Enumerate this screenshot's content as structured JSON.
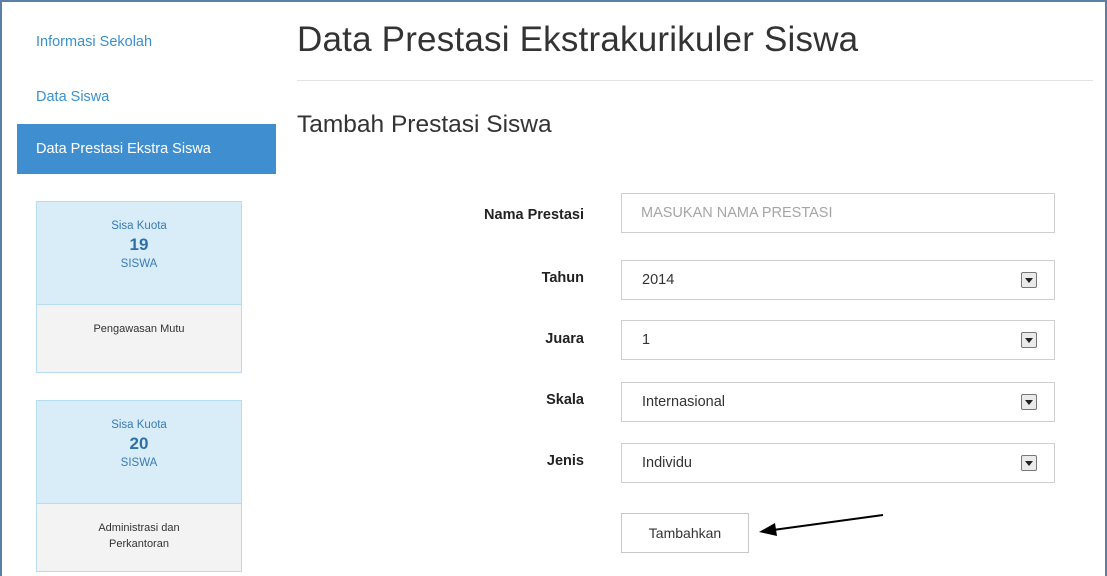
{
  "sidebar": {
    "items": [
      {
        "label": "Informasi Sekolah"
      },
      {
        "label": "Data Siswa"
      },
      {
        "label": "Data Prestasi Ekstra Siswa"
      }
    ],
    "quotas": [
      {
        "label": "Sisa Kuota",
        "count": "19",
        "unit": "SISWA",
        "program": "Pengawasan Mutu"
      },
      {
        "label": "Sisa Kuota",
        "count": "20",
        "unit": "SISWA",
        "program": "Administrasi dan Perkantoran"
      }
    ]
  },
  "main": {
    "title": "Data Prestasi Ekstrakurikuler Siswa",
    "subtitle": "Tambah Prestasi Siswa",
    "form": {
      "nama_label": "Nama Prestasi",
      "nama_placeholder": "MASUKAN NAMA PRESTASI",
      "tahun_label": "Tahun",
      "tahun_value": "2014",
      "juara_label": "Juara",
      "juara_value": "1",
      "skala_label": "Skala",
      "skala_value": "Internasional",
      "jenis_label": "Jenis",
      "jenis_value": "Individu",
      "submit_label": "Tambahkan"
    }
  },
  "icons": {
    "dropdown": "chevron-down-icon",
    "annotation": "arrow-left-icon"
  },
  "colors": {
    "accent": "#3f8fd0",
    "link": "#3a8fd0",
    "quota_bg": "#d8edf8"
  }
}
